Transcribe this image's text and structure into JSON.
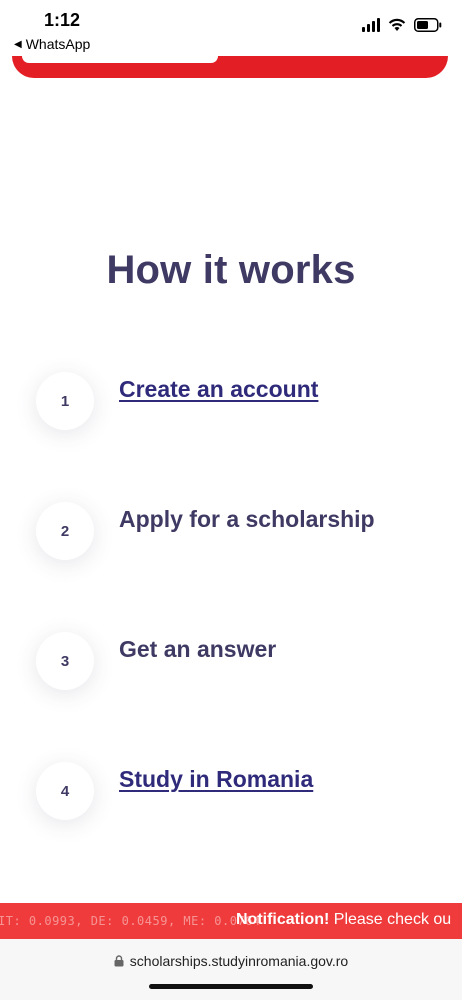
{
  "status_bar": {
    "time": "1:12",
    "back_app": "WhatsApp"
  },
  "section": {
    "title": "How it works"
  },
  "steps": [
    {
      "number": "1",
      "label": "Create an account",
      "is_link": true
    },
    {
      "number": "2",
      "label": "Apply for a scholarship",
      "is_link": false
    },
    {
      "number": "3",
      "label": "Get an answer",
      "is_link": false
    },
    {
      "number": "4",
      "label": "Study in Romania",
      "is_link": true
    }
  ],
  "ticker": {
    "faded_text": "IT: 0.0993, DE: 0.0459, ME: 0.0764",
    "notification_bold": "Notification!",
    "notification_text": " Please check ou"
  },
  "browser": {
    "url": "scholarships.studyinromania.gov.ro"
  },
  "colors": {
    "brand_red": "#e31e24",
    "ticker_red": "#ef3b3b",
    "heading": "#3f3a63",
    "link": "#2f2a7a"
  }
}
